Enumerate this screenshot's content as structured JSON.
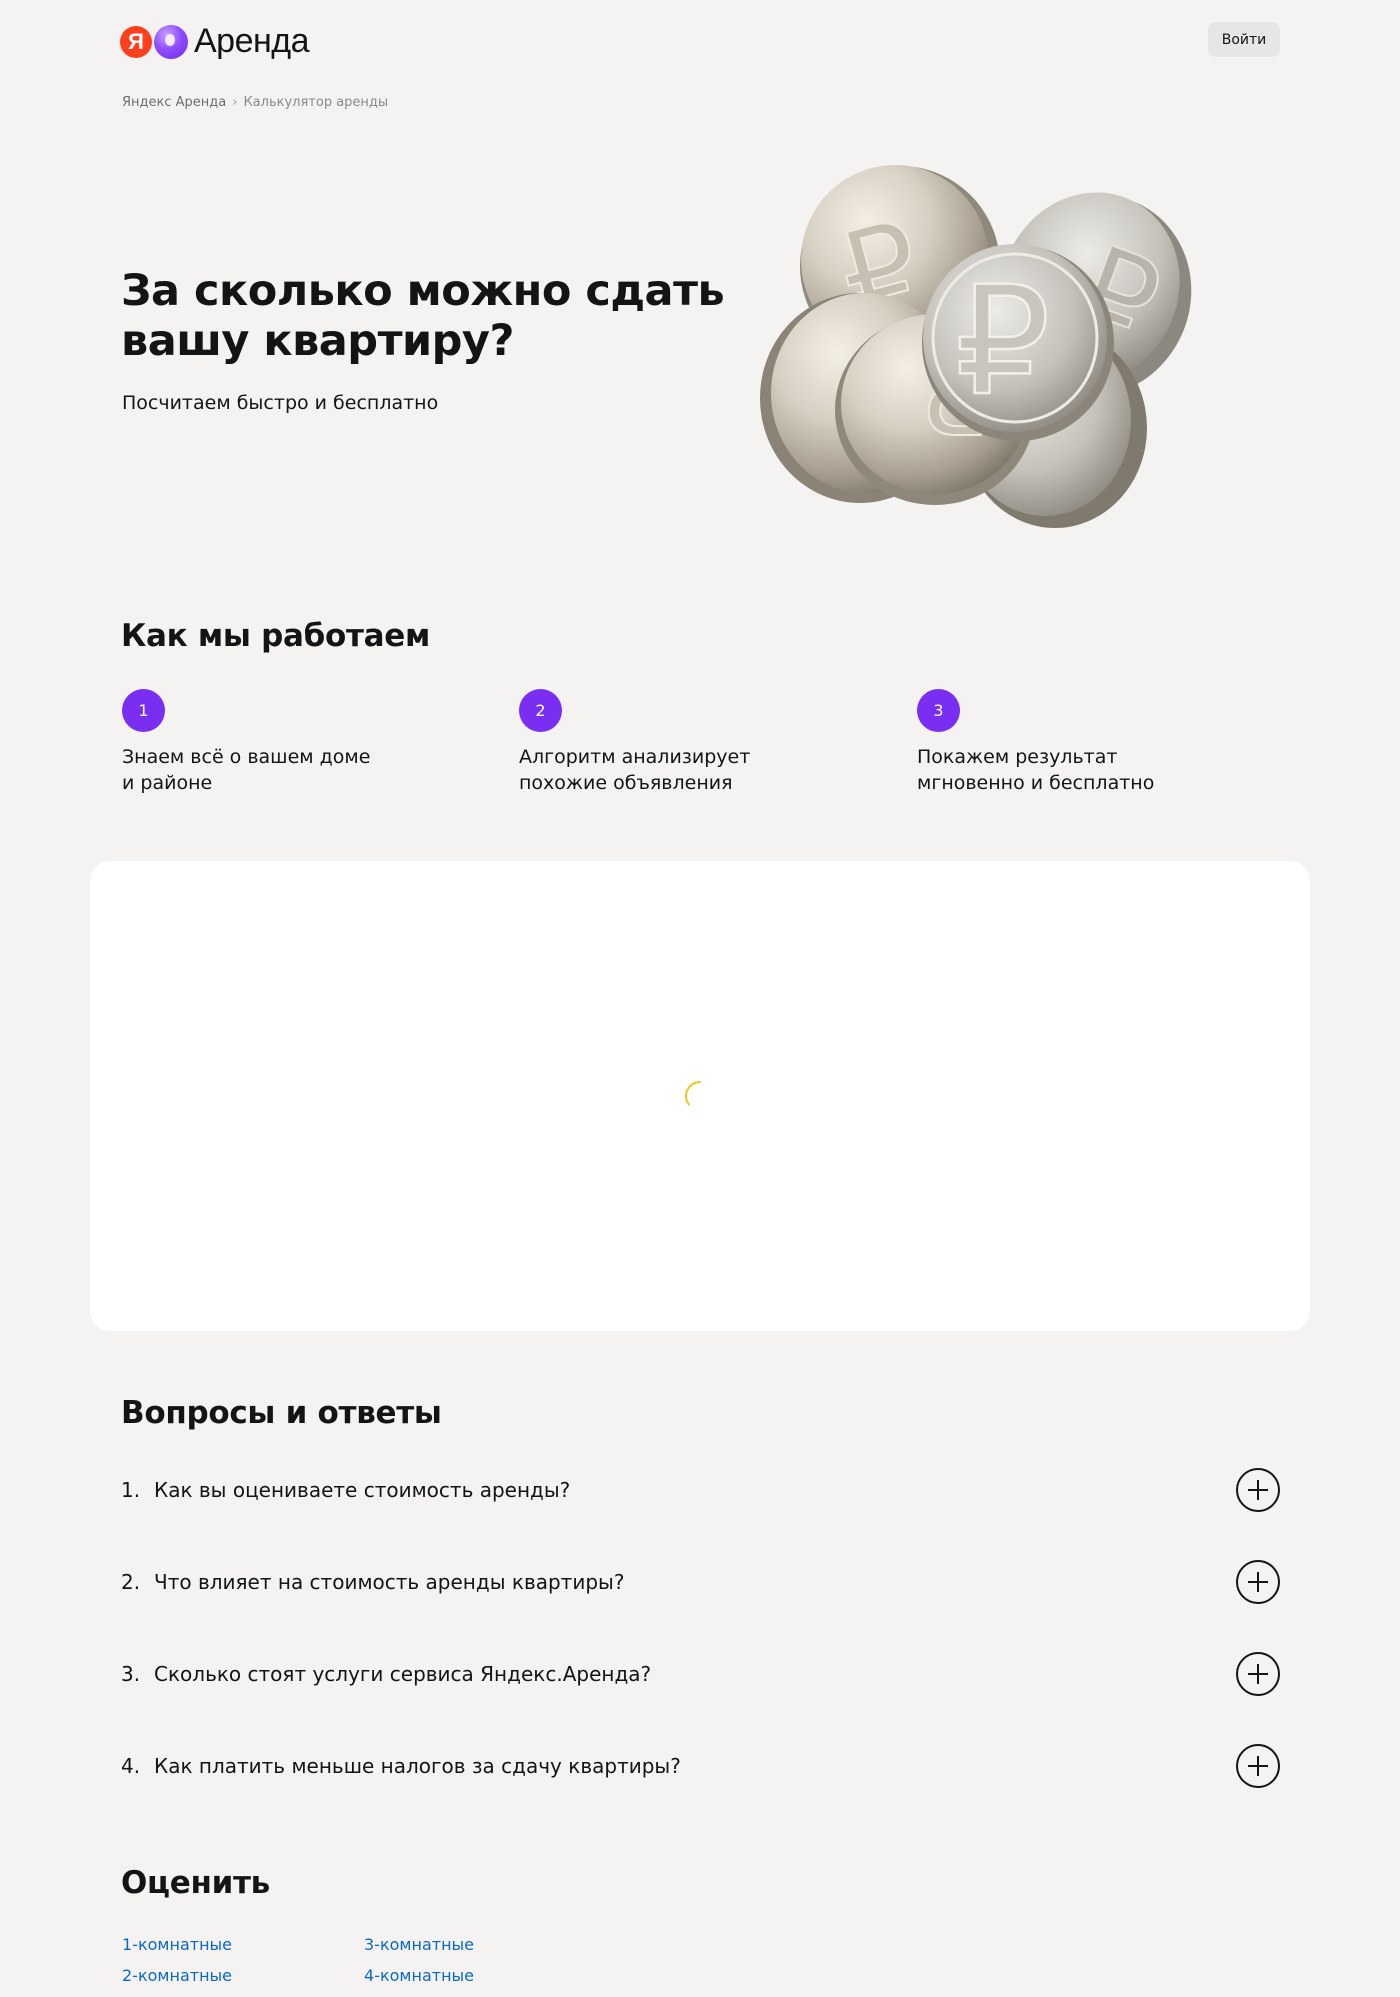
{
  "header": {
    "logo_ya": "Я",
    "logo_text": "Аренда",
    "login_label": "Войти"
  },
  "breadcrumb": {
    "home": "Яндекс Аренда",
    "separator": "›",
    "current": "Калькулятор аренды"
  },
  "hero": {
    "title": "За сколько можно сдать вашу квартиру?",
    "subtitle": "Посчитаем быстро и бесплатно"
  },
  "how": {
    "title": "Как мы работаем",
    "steps": [
      {
        "num": "1",
        "text": "Знаем всё о вашем доме и районе"
      },
      {
        "num": "2",
        "text": "Алгоритм анализирует похожие объявления"
      },
      {
        "num": "3",
        "text": "Покажем результат мгновенно и бесплатно"
      }
    ]
  },
  "calculator": {
    "state": "loading",
    "spinner_color": "#f5c518"
  },
  "faq": {
    "title": "Вопросы и ответы",
    "items": [
      {
        "num": "1.",
        "question": "Как вы оцениваете стоимость аренды?"
      },
      {
        "num": "2.",
        "question": "Что влияет на стоимость аренды квартиры?"
      },
      {
        "num": "3.",
        "question": "Сколько стоят услуги сервиса Яндекс.Аренда?"
      },
      {
        "num": "4.",
        "question": "Как платить меньше налогов за сдачу квартиры?"
      }
    ]
  },
  "evaluate": {
    "title": "Оценить",
    "links": [
      "1-комнатные",
      "2-комнатные",
      "3-комнатные",
      "4-комнатные"
    ]
  },
  "colors": {
    "accent": "#7a2ef2",
    "link": "#0a68c8",
    "background": "#f4f3f1",
    "logo_red": "#fc3f1d"
  }
}
